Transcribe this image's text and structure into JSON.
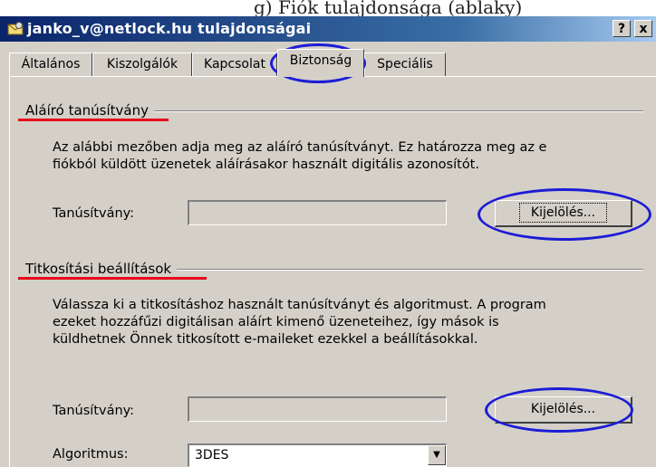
{
  "caption": "g) Fiók tulajdonsága (ablaky)",
  "window": {
    "title": "janko_v@netlock.hu tulajdonságai",
    "help_button": "?",
    "close_button": "x"
  },
  "tabs": [
    {
      "label": "Általános"
    },
    {
      "label": "Kiszolgálók"
    },
    {
      "label": "Kapcsolat"
    },
    {
      "label": "Biztonság"
    },
    {
      "label": "Speciális"
    }
  ],
  "signing": {
    "group_title": "Aláíró tanúsítvány",
    "description_line1": "Az alábbi mezőben adja meg az aláíró tanúsítványt. Ez határozza meg az e",
    "description_line2": "fiókból küldött üzenetek aláírásakor használt digitális azonosítót.",
    "cert_label": "Tanúsítvány:",
    "cert_value": "",
    "select_button": "Kijelölés..."
  },
  "encryption": {
    "group_title": "Titkosítási beállítások",
    "description_line1": "Válassza ki a titkosításhoz használt tanúsítványt és algoritmust. A program",
    "description_line2": "ezeket hozzáfűzi digitálisan aláírt kimenő üzeneteihez, így mások is",
    "description_line3": "küldhetnek Önnek titkosított e-maileket ezekkel a beállításokkal.",
    "cert_label": "Tanúsítvány:",
    "cert_value": "",
    "select_button": "Kijelölés...",
    "algorithm_label": "Algoritmus:",
    "algorithm_value": "3DES"
  },
  "colors": {
    "annotation_ellipse": "#1c1cd6",
    "annotation_underline": "#e8001c",
    "titlebar": "#0a246a",
    "dialog_face": "#d4d0c8"
  }
}
